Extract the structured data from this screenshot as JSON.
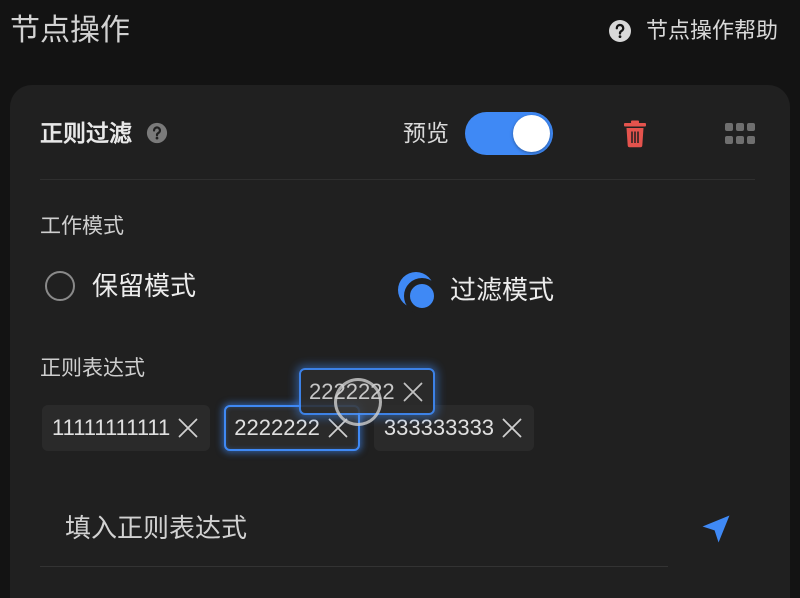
{
  "header": {
    "title": "节点操作",
    "help_label": "节点操作帮助",
    "help_icon": "question-circle-icon"
  },
  "filter_card": {
    "title": "正则过滤",
    "title_help_icon": "question-circle-icon",
    "preview": {
      "label": "预览",
      "enabled": true
    },
    "delete_icon": "trash-icon",
    "drag_handle_icon": "grid-dots-icon",
    "work_mode": {
      "label": "工作模式",
      "options": [
        {
          "label": "保留模式",
          "selected": false
        },
        {
          "label": "过滤模式",
          "selected": true
        }
      ]
    },
    "regex": {
      "label": "正则表达式",
      "tags": [
        {
          "text": "11111111111",
          "active": false
        },
        {
          "text": "2222222",
          "active": true
        },
        {
          "text": "333333333",
          "active": false
        }
      ],
      "remove_icon": "close-icon",
      "dragging_tag": "2222222",
      "input": {
        "placeholder": "填入正则表达式"
      },
      "submit_icon": "send-arrow-icon"
    }
  },
  "colors": {
    "background": "#131313",
    "card": "#202020",
    "accent": "#3f89f5",
    "danger": "#e4534d"
  }
}
